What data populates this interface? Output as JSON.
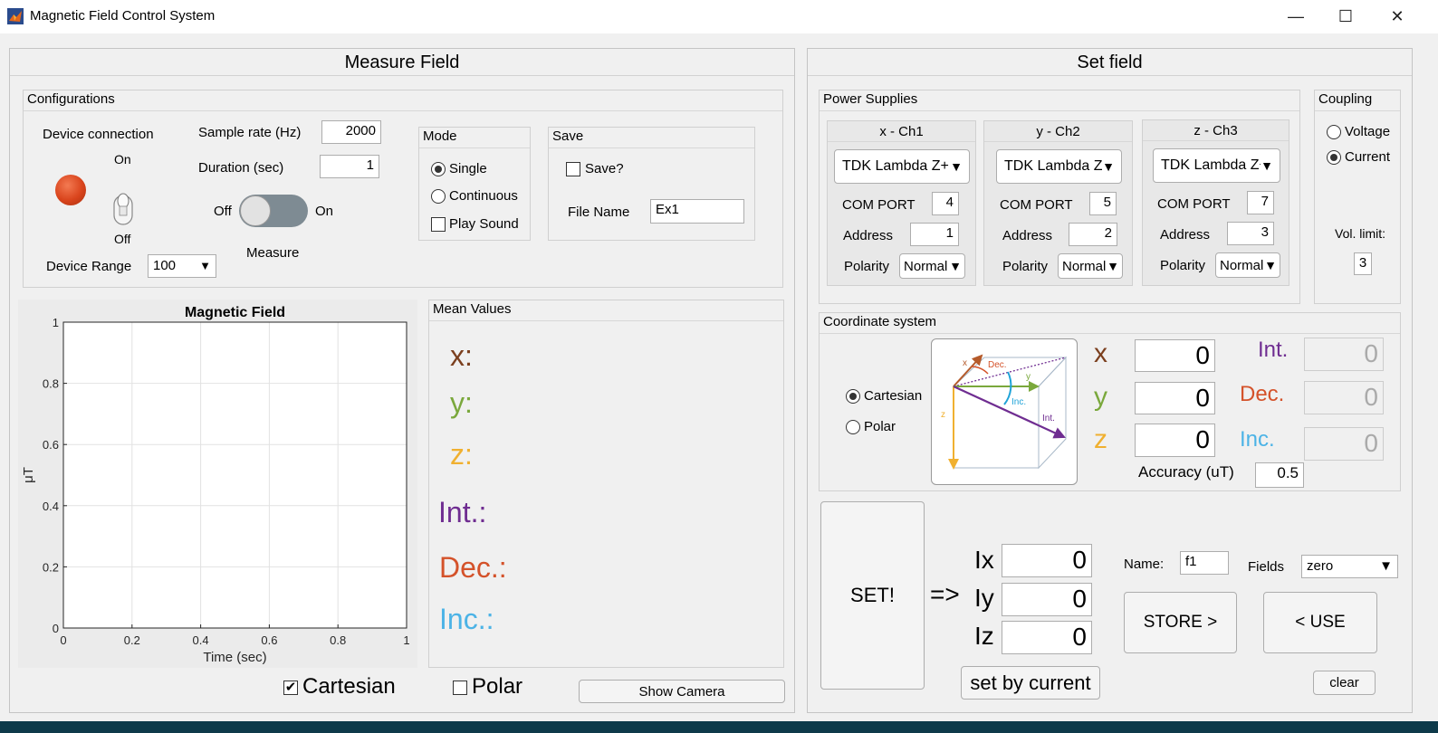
{
  "window": {
    "title": "Magnetic Field Control System",
    "icon": "matlab-icon",
    "minimize": "—",
    "maximize": "☐",
    "close": "✕"
  },
  "measure": {
    "header": "Measure Field",
    "config": {
      "title": "Configurations",
      "device_connection": "Device connection",
      "switch_on": "On",
      "switch_off": "Off",
      "device_range_label": "Device Range",
      "device_range_value": "100",
      "sample_rate_label": "Sample rate (Hz)",
      "sample_rate_value": "2000",
      "duration_label": "Duration (sec)",
      "duration_value": "1",
      "toggle_off": "Off",
      "toggle_on": "On",
      "measure_label": "Measure",
      "mode": {
        "title": "Mode",
        "single": "Single",
        "continuous": "Continuous",
        "play_sound": "Play Sound"
      },
      "save": {
        "title": "Save",
        "save_q": "Save?",
        "file_name_label": "File Name",
        "file_name_value": "Ex1"
      }
    },
    "chart_data": {
      "type": "line",
      "title": "Magnetic Field",
      "xlabel": "Time (sec)",
      "ylabel": "μT",
      "xlim": [
        0,
        1
      ],
      "ylim": [
        0,
        1
      ],
      "xticks": [
        "0",
        "0.2",
        "0.4",
        "0.6",
        "0.8",
        "1"
      ],
      "yticks": [
        "0",
        "0.2",
        "0.4",
        "0.6",
        "0.8",
        "1"
      ],
      "grid": true,
      "series": []
    },
    "mean_values": {
      "title": "Mean Values",
      "x": "x:",
      "y": "y:",
      "z": "z:",
      "int": "Int.:",
      "dec": "Dec.:",
      "inc": "Inc.:"
    },
    "cartesian_label": "Cartesian",
    "polar_label": "Polar",
    "show_camera": "Show Camera"
  },
  "setfield": {
    "header": "Set field",
    "power_supplies": {
      "title": "Power Supplies",
      "com_port_label": "COM PORT",
      "address_label": "Address",
      "polarity_label": "Polarity",
      "channels": [
        {
          "title": "x - Ch1",
          "device": "TDK Lambda Z+",
          "com_port": "4",
          "address": "1",
          "polarity": "Normal"
        },
        {
          "title": "y - Ch2",
          "device": "TDK Lambda Z+",
          "com_port": "5",
          "address": "2",
          "polarity": "Normal"
        },
        {
          "title": "z - Ch3",
          "device": "TDK Lambda Z+",
          "com_port": "7",
          "address": "3",
          "polarity": "Normal"
        }
      ]
    },
    "coupling": {
      "title": "Coupling",
      "voltage": "Voltage",
      "current": "Current",
      "vol_limit_label": "Vol. limit:",
      "vol_limit_value": "3"
    },
    "coordinate": {
      "title": "Coordinate system",
      "cartesian": "Cartesian",
      "polar": "Polar",
      "diagram": {
        "x": "x",
        "dec": "Dec.",
        "y": "y",
        "inc": "Inc.",
        "int": "Int.",
        "z": "z"
      },
      "x_label": "x",
      "y_label": "y",
      "z_label": "z",
      "x_value": "0",
      "y_value": "0",
      "z_value": "0",
      "int_label": "Int.",
      "dec_label": "Dec.",
      "inc_label": "Inc.",
      "int_value": "0",
      "dec_value": "0",
      "inc_value": "0",
      "accuracy_label": "Accuracy (uT)",
      "accuracy_value": "0.5"
    },
    "set_button": "SET!",
    "arrow": "=>",
    "ix_label": "Ix",
    "iy_label": "Iy",
    "iz_label": "Iz",
    "ix_value": "0",
    "iy_value": "0",
    "iz_value": "0",
    "set_by_current": "set by current",
    "name_label": "Name:",
    "name_value": "f1",
    "fields_label": "Fields",
    "fields_value": "zero",
    "store_button": "STORE >",
    "use_button": "< USE",
    "clear_button": "clear"
  },
  "colors": {
    "x": "#7b3f1e",
    "y": "#7aa83c",
    "z": "#f0b030",
    "int": "#6f2d91",
    "dec": "#d4522a",
    "inc": "#4cb3e6",
    "led": "#d9441c"
  }
}
